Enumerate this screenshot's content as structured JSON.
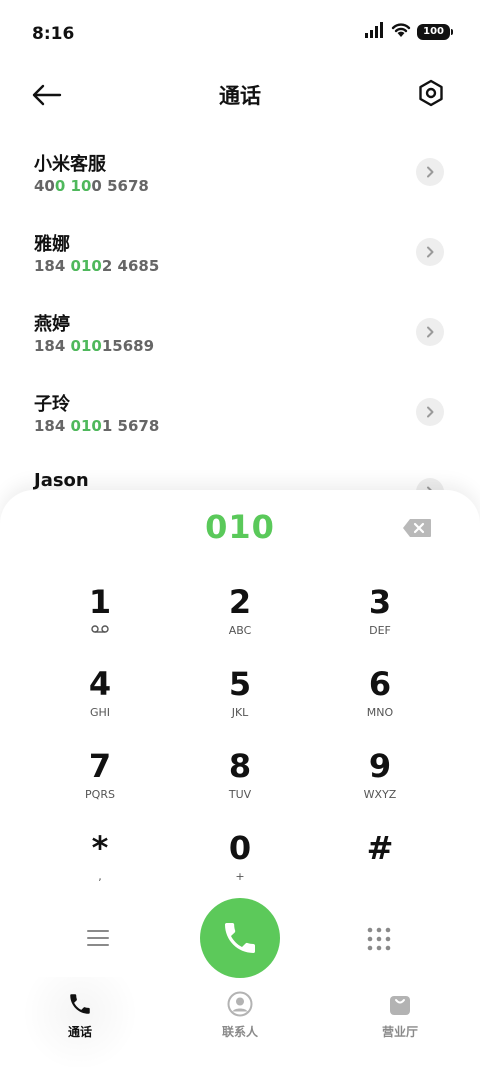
{
  "status_bar": {
    "time": "8:16",
    "battery": "100"
  },
  "header": {
    "title": "通话"
  },
  "contacts": [
    {
      "name": "小米客服",
      "number_parts": [
        "40",
        "0 10",
        "0 5678"
      ]
    },
    {
      "name": "雅娜",
      "number_parts": [
        "184 ",
        "010",
        "2 4685"
      ]
    },
    {
      "name": "燕婷",
      "number_parts": [
        "184 ",
        "010",
        "15689"
      ]
    },
    {
      "name": "子玲",
      "number_parts": [
        "184 ",
        "010",
        "1 5678"
      ]
    },
    {
      "name": "Jason",
      "number_parts": [
        "",
        "",
        ""
      ]
    }
  ],
  "dialpad": {
    "input": "010",
    "keys": [
      {
        "digit": "1",
        "letters": ""
      },
      {
        "digit": "2",
        "letters": "ABC"
      },
      {
        "digit": "3",
        "letters": "DEF"
      },
      {
        "digit": "4",
        "letters": "GHI"
      },
      {
        "digit": "5",
        "letters": "JKL"
      },
      {
        "digit": "6",
        "letters": "MNO"
      },
      {
        "digit": "7",
        "letters": "PQRS"
      },
      {
        "digit": "8",
        "letters": "TUV"
      },
      {
        "digit": "9",
        "letters": "WXYZ"
      },
      {
        "digit": "*",
        "letters": ","
      },
      {
        "digit": "0",
        "letters": "+"
      },
      {
        "digit": "#",
        "letters": ""
      }
    ]
  },
  "bottom_nav": {
    "calls": "通话",
    "contacts": "联系人",
    "store": "营业厅"
  },
  "colors": {
    "accent_green": "#5cc95a",
    "highlight_green": "#4fb85c"
  },
  "icons": {
    "voicemail": "voicemail-icon",
    "call": "phone-icon",
    "back": "arrow-left-icon",
    "settings": "hexagon-gear-icon",
    "backspace": "backspace-icon"
  }
}
